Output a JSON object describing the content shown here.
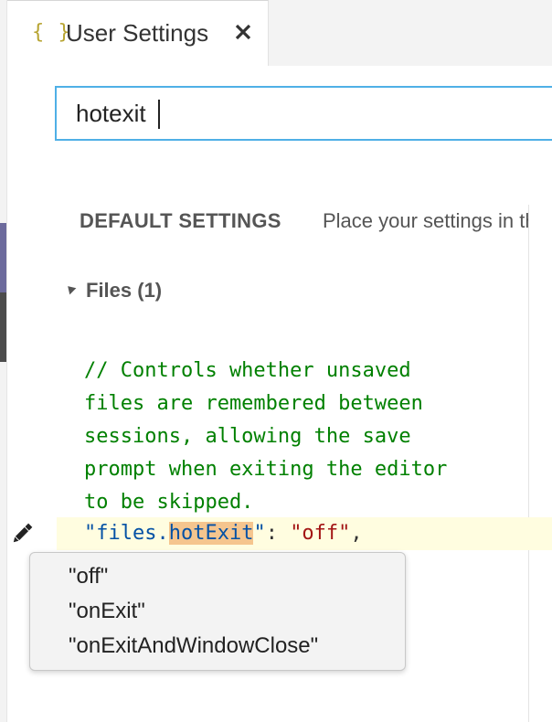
{
  "tab": {
    "icon": "{ }",
    "title": "User Settings",
    "close_icon": "close-icon"
  },
  "search": {
    "value": "hotexit",
    "placeholder": ""
  },
  "default_settings": {
    "header": "DEFAULT SETTINGS",
    "description": "Place your settings in the right hand side editor to override."
  },
  "group": {
    "title": "Files (1)"
  },
  "code": {
    "comment": "// Controls whether unsaved\nfiles are remembered between\nsessions, allowing the save\nprompt when exiting the editor\nto be skipped.",
    "key_prefix": "\"files.",
    "key_highlight": "hotExit",
    "key_suffix": "\"",
    "colon": ": ",
    "value": "\"off\"",
    "comma": ","
  },
  "suggestions": [
    "\"off\"",
    "\"onExit\"",
    "\"onExitAndWindowClose\""
  ],
  "colors": {
    "accent": "#4fb0e6",
    "comment": "#008000",
    "key": "#0451a5",
    "string": "#a31515",
    "match_highlight": "#f5c58e",
    "line_highlight": "#fffde0"
  },
  "icons": {
    "tab": "json-braces-icon",
    "edit": "pencil-icon",
    "collapse": "triangle-down-icon"
  }
}
